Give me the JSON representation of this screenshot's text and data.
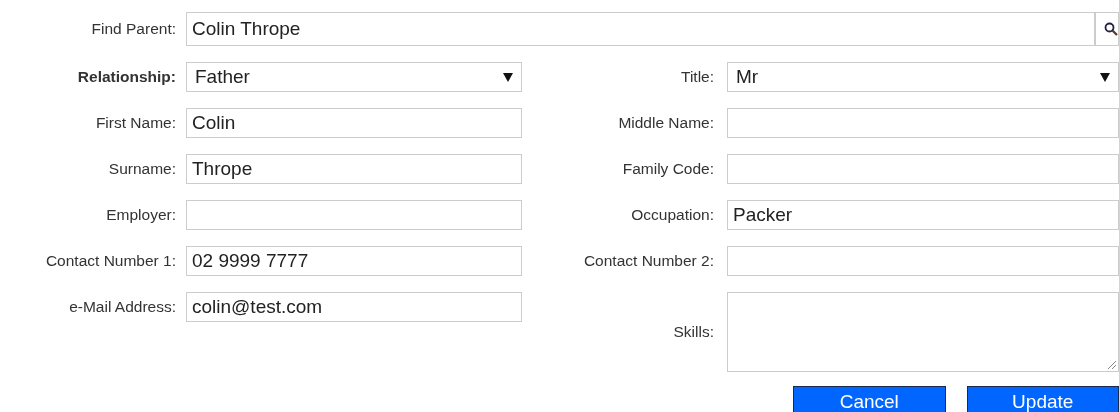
{
  "find_parent": {
    "label": "Find Parent:",
    "value": "Colin Thrope"
  },
  "left_fields": [
    {
      "kind": "select",
      "label": "Relationship:",
      "bold": true,
      "value": "Father"
    },
    {
      "kind": "text",
      "label": "First Name:",
      "bold": false,
      "value": "Colin"
    },
    {
      "kind": "text",
      "label": "Surname:",
      "bold": false,
      "value": "Thrope"
    },
    {
      "kind": "text",
      "label": "Employer:",
      "bold": false
    },
    {
      "kind": "text",
      "label": "Contact Number 1:",
      "bold": false,
      "value": "02 9999 7777"
    },
    {
      "kind": "text",
      "label": "e-Mail Address:",
      "bold": false,
      "value": "colin@test.com"
    }
  ],
  "right_fields": [
    {
      "kind": "select",
      "label": "Title:",
      "bold": false,
      "value": "Mr"
    },
    {
      "kind": "text",
      "label": "Middle Name:",
      "bold": false
    },
    {
      "kind": "text",
      "label": "Family Code:",
      "bold": false
    },
    {
      "kind": "text",
      "label": "Occupation:",
      "bold": false,
      "value": "Packer"
    },
    {
      "kind": "text",
      "label": "Contact Number 2:",
      "bold": false
    },
    {
      "kind": "textarea",
      "label": "Skills:",
      "bold": false
    }
  ],
  "buttons": [
    "Cancel",
    "Update"
  ]
}
